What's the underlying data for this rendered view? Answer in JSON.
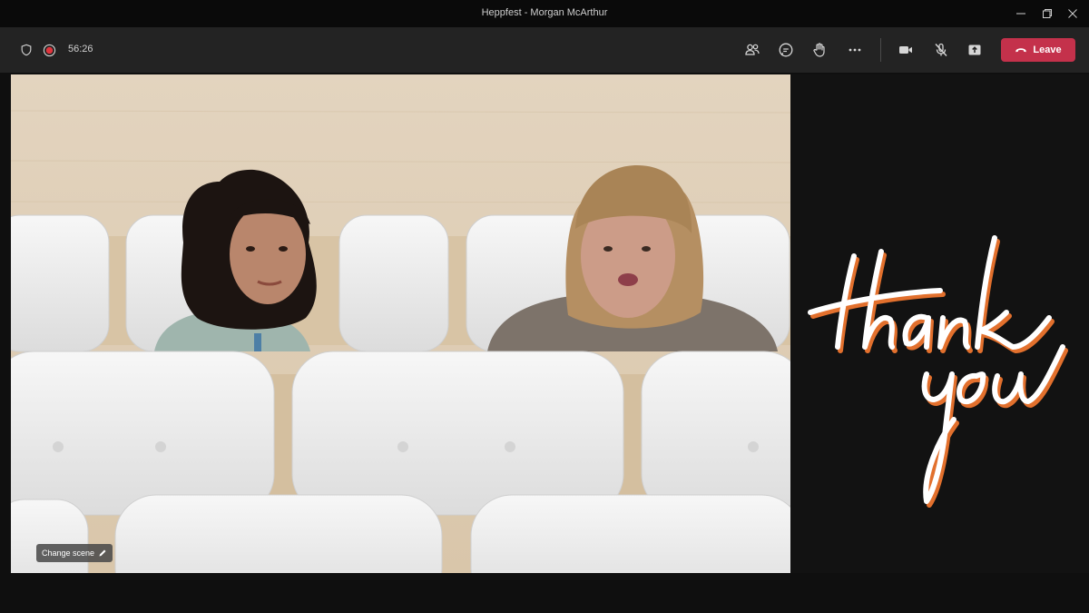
{
  "window": {
    "title": "Heppfest - Morgan McArthur"
  },
  "toolbar": {
    "timer": "56:26",
    "leave_label": "Leave",
    "icons": [
      "shield-icon",
      "record-icon",
      "people-icon",
      "chat-icon",
      "raise-hand-icon",
      "more-icon",
      "camera-off-icon",
      "mic-off-icon",
      "share-icon",
      "phone-icon"
    ],
    "leave_color": "#c4314b"
  },
  "scene": {
    "change_scene_label": "Change scene"
  },
  "share": {
    "artwork": "thank you"
  }
}
